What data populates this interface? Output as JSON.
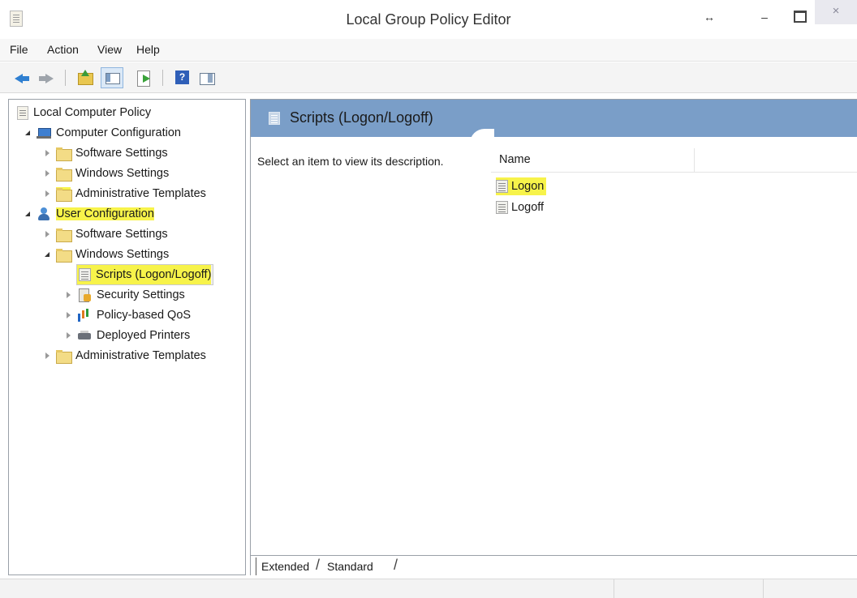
{
  "window": {
    "title": "Local Group Policy Editor",
    "resize_glyph": "↔",
    "minimize_glyph": "–",
    "close_glyph": "×"
  },
  "menu": {
    "items": [
      "File",
      "Action",
      "View",
      "Help"
    ]
  },
  "toolbar": {
    "buttons": [
      "back-icon",
      "forward-icon",
      "up-one-level-icon",
      "show-hide-tree-icon",
      "export-list-icon",
      "help-icon",
      "properties-icon"
    ]
  },
  "tree": {
    "root": "Local Computer Policy",
    "computer_config": "Computer Configuration",
    "cc_software": "Software Settings",
    "cc_windows": "Windows Settings",
    "cc_admin": "Administrative Templates",
    "user_config": "User Configuration",
    "uc_software": "Software Settings",
    "uc_windows": "Windows Settings",
    "scripts": "Scripts (Logon/Logoff)",
    "security": "Security Settings",
    "qos": "Policy-based QoS",
    "printers": "Deployed Printers",
    "uc_admin": "Administrative Templates"
  },
  "details": {
    "header_title": "Scripts (Logon/Logoff)",
    "description": "Select an item to view its description.",
    "column_name": "Name",
    "items": [
      "Logon",
      "Logoff"
    ]
  },
  "tabs": {
    "extended": "Extended",
    "standard": "Standard"
  },
  "colors": {
    "highlight": "#f7f34a",
    "header_band": "#7a9ec8"
  }
}
